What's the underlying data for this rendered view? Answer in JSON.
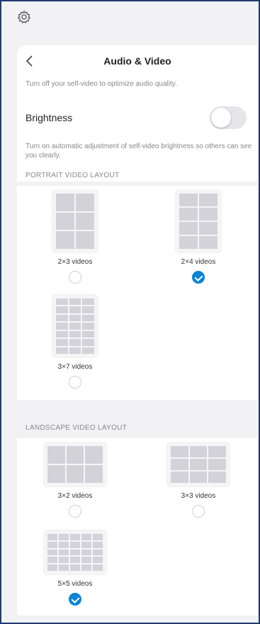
{
  "header": {
    "title": "Audio & Video"
  },
  "hints": {
    "self_video": "Turn off your self-video to optimize audio quality.",
    "brightness": "Turn on automatic adjustment of self-video brightness so others can see you clearly."
  },
  "brightness": {
    "label": "Brightness",
    "enabled": false
  },
  "portrait": {
    "label": "PORTRAIT VIDEO LAYOUT",
    "options": [
      {
        "label": "2×3 videos",
        "selected": false
      },
      {
        "label": "2×4 videos",
        "selected": true
      },
      {
        "label": "3×7 videos",
        "selected": false
      }
    ]
  },
  "landscape": {
    "label": "LANDSCAPE VIDEO LAYOUT",
    "options": [
      {
        "label": "3×2 videos",
        "selected": false
      },
      {
        "label": "3×3 videos",
        "selected": false
      },
      {
        "label": "5×5 videos",
        "selected": true
      }
    ]
  },
  "icons": {
    "settings": "gear-icon",
    "back": "chevron-left-icon",
    "selected": "checkmark-icon"
  },
  "colors": {
    "accent": "#0a84d6",
    "window_border": "#1f3b73"
  }
}
